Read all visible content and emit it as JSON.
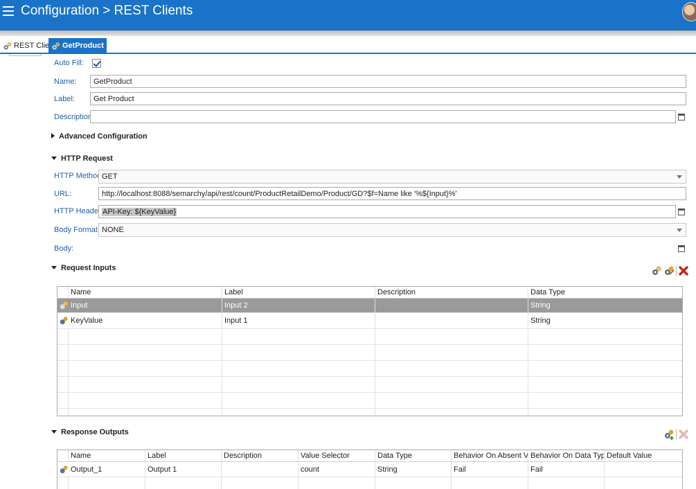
{
  "header": {
    "title": "Configuration > REST Clients",
    "menu_icon": "hamburger-menu-icon",
    "avatar_icon": "user-avatar-icon",
    "bar_color": "#1a73c8"
  },
  "tabs": [
    {
      "label": "REST Clients",
      "icon": "rest-client-gear-icon",
      "active": false
    },
    {
      "label": "GetProduct",
      "icon": "rest-client-gear-icon",
      "active": true,
      "close": "✕"
    }
  ],
  "form": {
    "auto_fill": {
      "label": "Auto Fill:",
      "checked": true
    },
    "name": {
      "label": "Name:",
      "value": "GetProduct"
    },
    "label": {
      "label": "Label:",
      "value": "Get Product"
    },
    "description": {
      "label": "Description:",
      "value": ""
    }
  },
  "sections": {
    "advanced": "Advanced Configuration",
    "http_request": "HTTP Request",
    "request_inputs": "Request Inputs",
    "response_outputs": "Response Outputs"
  },
  "http": {
    "method": {
      "label": "HTTP Method:",
      "value": "GET"
    },
    "url": {
      "label": "URL:",
      "value": "http://localhost:8088/semarchy/api/rest/count/ProductRetailDemo/Product/GD?$f=Name like '%${Input}%'"
    },
    "headers": {
      "label": "HTTP Headers:",
      "value": "API-Key: ${KeyValue}"
    },
    "body_format": {
      "label": "Body Format:",
      "value": "NONE"
    },
    "body": {
      "label": "Body:"
    }
  },
  "request_inputs": {
    "columns": [
      "Name",
      "Label",
      "Description",
      "Data Type"
    ],
    "rows": [
      {
        "name": "Input",
        "label": "Input 2",
        "description": "",
        "data_type": "String",
        "selected": true
      },
      {
        "name": "KeyValue",
        "label": "Input 1",
        "description": "",
        "data_type": "String",
        "selected": false
      }
    ],
    "toolbar": [
      "add-input-icon",
      "edit-input-icon",
      "delete-icon"
    ]
  },
  "response_outputs": {
    "columns": [
      "Name",
      "Label",
      "Description",
      "Value Selector",
      "Data Type",
      "Behavior On Absent Value",
      "Behavior On Data Type ...",
      "Default Value"
    ],
    "rows": [
      {
        "name": "Output_1",
        "label": "Output 1",
        "description": "",
        "value_selector": "count",
        "data_type": "String",
        "absent": "Fail",
        "type_error": "Fail",
        "default": ""
      }
    ],
    "toolbar": [
      "add-output-icon",
      "delete-icon-disabled"
    ]
  }
}
